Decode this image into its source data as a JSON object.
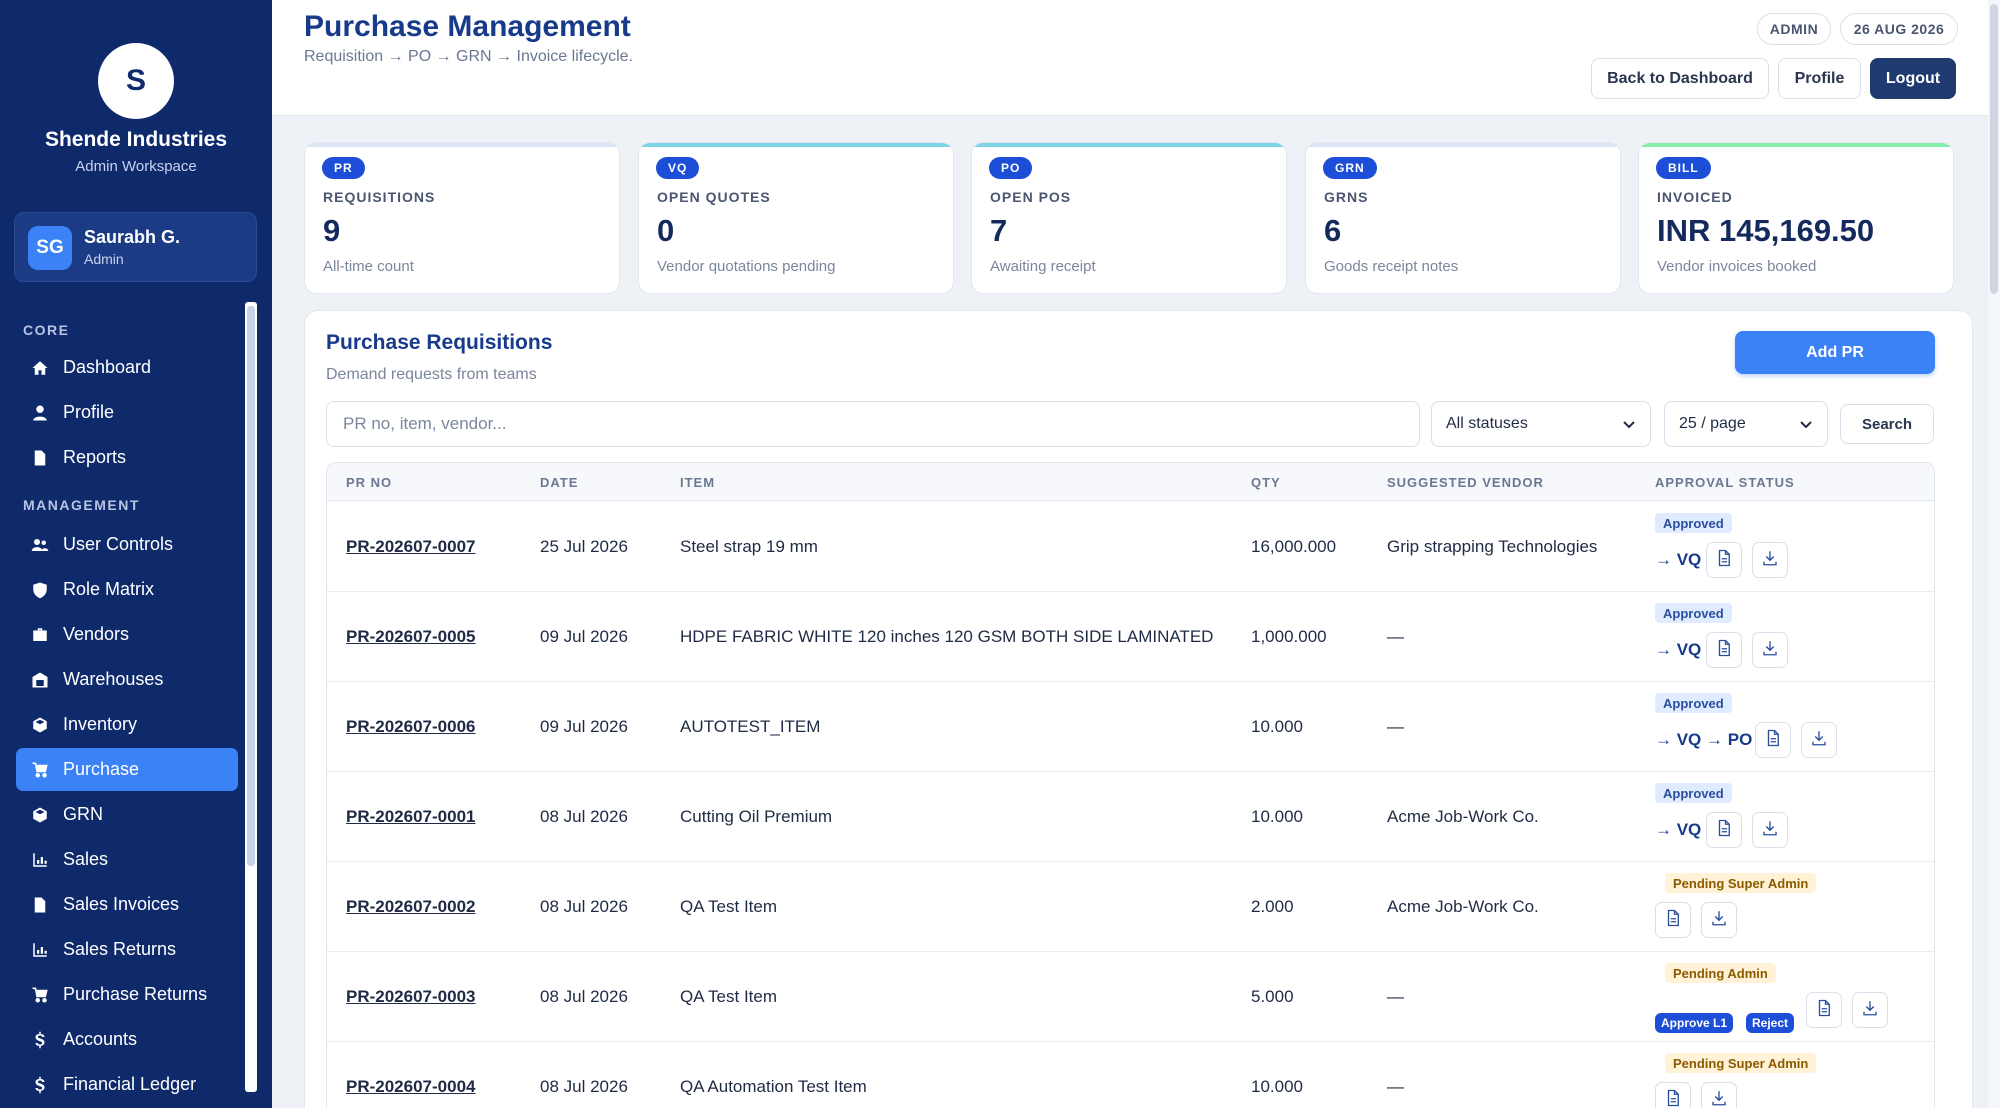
{
  "sidebar": {
    "logo_letter": "S",
    "company": "Shende Industries",
    "workspace": "Admin Workspace",
    "user": {
      "initials": "SG",
      "name": "Saurabh G.",
      "role": "Admin"
    },
    "sections": {
      "core": "CORE",
      "management": "MANAGEMENT"
    },
    "items": [
      {
        "label": "Dashboard",
        "icon": "home-icon"
      },
      {
        "label": "Profile",
        "icon": "user-icon"
      },
      {
        "label": "Reports",
        "icon": "document-icon"
      },
      {
        "label": "User Controls",
        "icon": "users-icon"
      },
      {
        "label": "Role Matrix",
        "icon": "shield-icon"
      },
      {
        "label": "Vendors",
        "icon": "briefcase-icon"
      },
      {
        "label": "Warehouses",
        "icon": "warehouse-icon"
      },
      {
        "label": "Inventory",
        "icon": "box-icon"
      },
      {
        "label": "Purchase",
        "icon": "cart-icon",
        "active": true
      },
      {
        "label": "GRN",
        "icon": "box-icon"
      },
      {
        "label": "Sales",
        "icon": "bar-chart-icon"
      },
      {
        "label": "Sales Invoices",
        "icon": "document-icon"
      },
      {
        "label": "Sales Returns",
        "icon": "bar-chart-icon"
      },
      {
        "label": "Purchase Returns",
        "icon": "cart-icon"
      },
      {
        "label": "Accounts",
        "icon": "dollar-icon"
      },
      {
        "label": "Financial Ledger",
        "icon": "dollar-icon"
      }
    ]
  },
  "header": {
    "title": "Purchase Management",
    "subtitle": "Requisition → PO → GRN → Invoice lifecycle.",
    "role_pill": "ADMIN",
    "date_pill": "26 AUG 2026",
    "back_label": "Back to Dashboard",
    "profile_label": "Profile",
    "logout_label": "Logout"
  },
  "kpis": [
    {
      "tag": "PR",
      "label": "REQUISITIONS",
      "value": "9",
      "caption": "All-time count",
      "accent": "#dbe6f5"
    },
    {
      "tag": "VQ",
      "label": "OPEN QUOTES",
      "value": "0",
      "caption": "Vendor quotations pending",
      "accent": "#7dd3e8"
    },
    {
      "tag": "PO",
      "label": "OPEN POS",
      "value": "7",
      "caption": "Awaiting receipt",
      "accent": "#7dd3e8"
    },
    {
      "tag": "GRN",
      "label": "GRNS",
      "value": "6",
      "caption": "Goods receipt notes",
      "accent": "#dbe6f5"
    },
    {
      "tag": "BILL",
      "label": "INVOICED",
      "value": "INR 145,169.50",
      "caption": "Vendor invoices booked",
      "accent": "#86efac"
    }
  ],
  "panel": {
    "title": "Purchase Requisitions",
    "subtitle": "Demand requests from teams",
    "add_label": "Add PR",
    "search_placeholder": "PR no, item, vendor...",
    "status_filter": "All statuses",
    "page_size": "25 / page",
    "search_label": "Search"
  },
  "table": {
    "columns": [
      "PR NO",
      "DATE",
      "ITEM",
      "QTY",
      "SUGGESTED VENDOR",
      "APPROVAL STATUS"
    ],
    "rows": [
      {
        "pr_no": "PR-202607-0007",
        "date": "25 Jul 2026",
        "item": "Steel strap 19 mm",
        "qty": "16,000.000",
        "vendor": "Grip strapping Technologies",
        "status": "Approved",
        "flow": "→ VQ"
      },
      {
        "pr_no": "PR-202607-0005",
        "date": "09 Jul 2026",
        "item": "HDPE FABRIC WHITE 120 inches 120 GSM BOTH SIDE LAMINATED",
        "qty": "1,000.000",
        "vendor": "—",
        "status": "Approved",
        "flow": "→ VQ"
      },
      {
        "pr_no": "PR-202607-0006",
        "date": "09 Jul 2026",
        "item": "AUTOTEST_ITEM",
        "qty": "10.000",
        "vendor": "—",
        "status": "Approved",
        "flow": "→ VQ → PO"
      },
      {
        "pr_no": "PR-202607-0001",
        "date": "08 Jul 2026",
        "item": "Cutting Oil Premium",
        "qty": "10.000",
        "vendor": "Acme Job-Work Co.",
        "status": "Approved",
        "flow": "→ VQ"
      },
      {
        "pr_no": "PR-202607-0002",
        "date": "08 Jul 2026",
        "item": "QA Test Item",
        "qty": "2.000",
        "vendor": "Acme Job-Work Co.",
        "status": "Pending Super Admin",
        "flow": ""
      },
      {
        "pr_no": "PR-202607-0003",
        "date": "08 Jul 2026",
        "item": "QA Test Item",
        "qty": "5.000",
        "vendor": "—",
        "status": "Pending Admin",
        "flow": "",
        "approve_label": "Approve L1",
        "reject_label": "Reject"
      },
      {
        "pr_no": "PR-202607-0004",
        "date": "08 Jul 2026",
        "item": "QA Automation Test Item",
        "qty": "10.000",
        "vendor": "—",
        "status": "Pending Super Admin",
        "flow": ""
      }
    ]
  }
}
